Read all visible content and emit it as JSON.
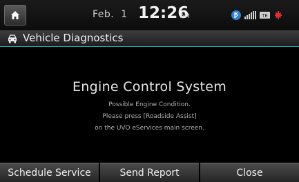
{
  "status_bar": {
    "date": "Feb.  1",
    "time": "12:26",
    "ampm": "AM",
    "icons": [
      "bluetooth-icon",
      "signal-icon",
      "network-icon",
      "alert-icon"
    ]
  },
  "title_bar": {
    "icon": "car-icon",
    "title": "Vehicle Diagnostics"
  },
  "message": {
    "heading": "Engine Control System",
    "line1": "Possible Engine Condition.",
    "line2": "Please press [Roadside Assist]",
    "line3": "on the UVO eServices main screen."
  },
  "buttons": {
    "schedule": "Schedule Service",
    "send": "Send Report",
    "close": "Close"
  },
  "colors": {
    "accent": "#1aa7b5",
    "alert": "#e23030"
  }
}
